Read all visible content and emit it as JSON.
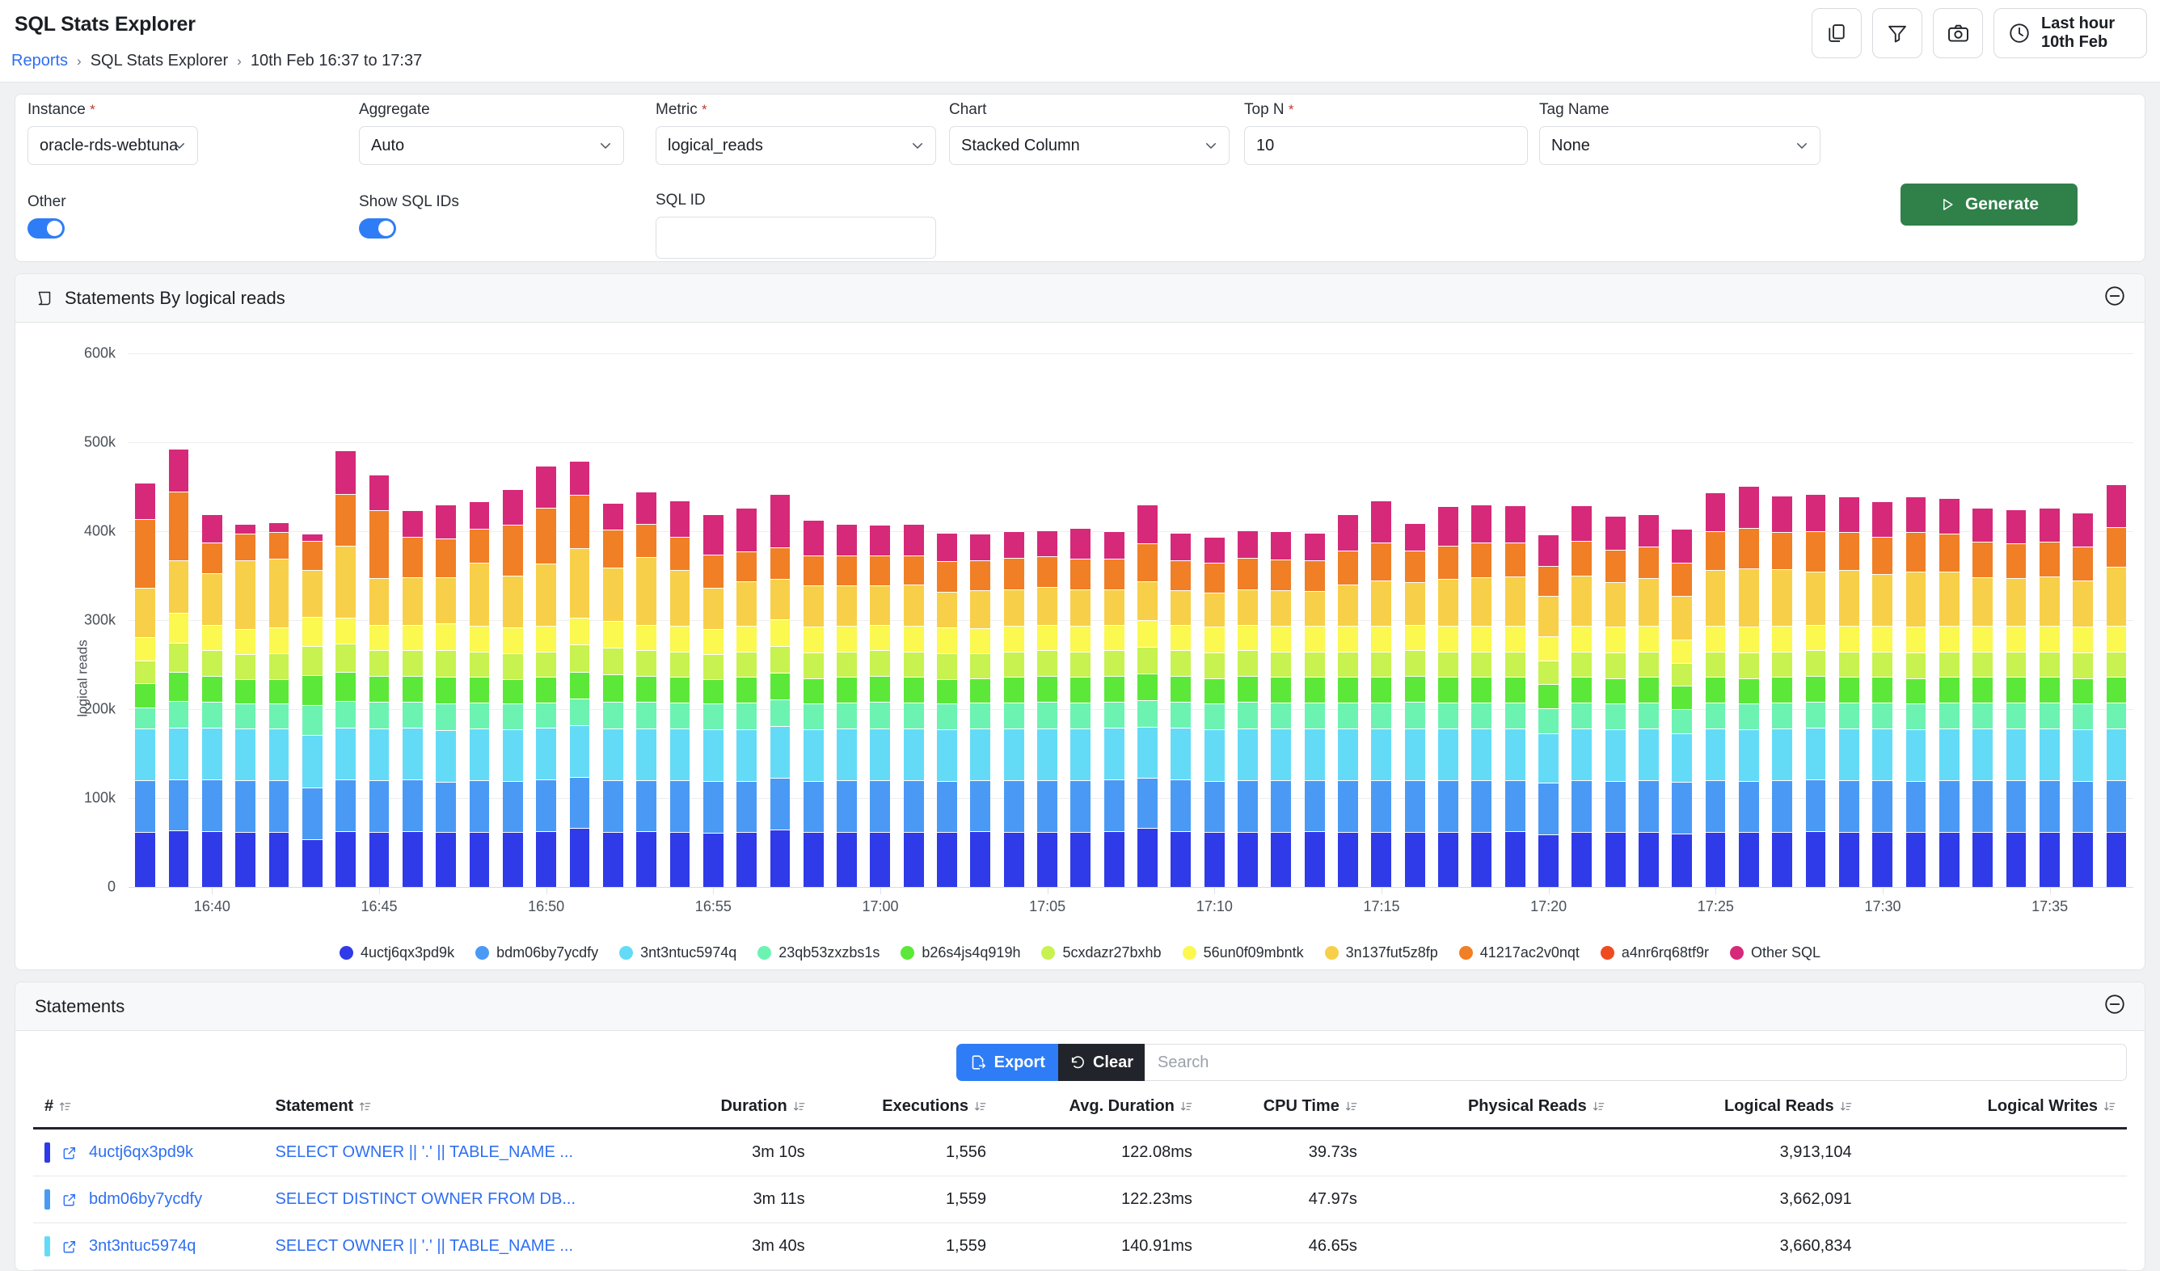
{
  "header": {
    "title": "SQL Stats Explorer",
    "breadcrumb": [
      {
        "label": "Reports",
        "link": true
      },
      {
        "label": "SQL Stats Explorer",
        "link": false
      },
      {
        "label": "10th Feb 16:37 to 17:37",
        "link": false
      }
    ],
    "actions": [
      {
        "name": "copy-icon",
        "label": "Copy"
      },
      {
        "name": "filter-icon",
        "label": "Filter"
      },
      {
        "name": "camera-icon",
        "label": "Snapshot"
      }
    ],
    "time_range": {
      "line1": "Last hour",
      "line2": "10th Feb"
    }
  },
  "filters": {
    "instance": {
      "label": "Instance",
      "required": "*",
      "value": "oracle-rds-webtuna"
    },
    "aggregate": {
      "label": "Aggregate",
      "required": "",
      "value": "Auto"
    },
    "metric": {
      "label": "Metric",
      "required": "*",
      "value": "logical_reads"
    },
    "chart": {
      "label": "Chart",
      "required": "",
      "value": "Stacked Column"
    },
    "topn": {
      "label": "Top N",
      "required": "*",
      "value": "10"
    },
    "tagname": {
      "label": "Tag Name",
      "required": "",
      "value": "None"
    },
    "other": {
      "label": "Other",
      "on": true
    },
    "show_sql_ids": {
      "label": "Show SQL IDs",
      "on": true
    },
    "sql_id": {
      "label": "SQL ID",
      "value": "",
      "placeholder": ""
    },
    "generate_label": "Generate"
  },
  "chart_panel": {
    "title": "Statements By logical reads",
    "collapse_label": "⊖"
  },
  "chart_data": {
    "type": "bar",
    "stacked": true,
    "title": "Statements By logical reads",
    "xlabel": "",
    "ylabel": "logical reads",
    "ylim": [
      0,
      600000
    ],
    "yticks": [
      0,
      100000,
      200000,
      300000,
      400000,
      500000,
      600000
    ],
    "ytick_labels": [
      "0",
      "100k",
      "200k",
      "300k",
      "400k",
      "500k",
      "600k"
    ],
    "grid": true,
    "legend_position": "bottom",
    "xtick_labels": [
      "16:40",
      "16:45",
      "16:50",
      "16:55",
      "17:00",
      "17:05",
      "17:10",
      "17:15",
      "17:20",
      "17:25",
      "17:30",
      "17:35"
    ],
    "series": [
      {
        "name": "4uctj6qx3pd9k",
        "color": "#2f3ae8",
        "values": [
          62000,
          64000,
          63000,
          62000,
          62000,
          54000,
          63000,
          62000,
          63000,
          62000,
          62000,
          62000,
          63000,
          66000,
          62000,
          63000,
          62000,
          61000,
          62000,
          65000,
          62000,
          62000,
          62000,
          62000,
          62000,
          63000,
          62000,
          62000,
          62000,
          63000,
          66000,
          63000,
          62000,
          62000,
          62000,
          63000,
          62000,
          62000,
          62000,
          62000,
          62000,
          63000,
          59000,
          62000,
          62000,
          62000,
          60000,
          62000,
          62000,
          62000,
          63000,
          62000,
          62000,
          62000,
          62000,
          62000,
          62000,
          62000,
          62000,
          62000
        ]
      },
      {
        "name": "bdm06by7ycdfy",
        "color": "#4a9af5",
        "values": [
          58000,
          57000,
          58000,
          58000,
          58000,
          58000,
          58000,
          58000,
          58000,
          56000,
          58000,
          57000,
          58000,
          58000,
          58000,
          57000,
          58000,
          58000,
          57000,
          58000,
          57000,
          58000,
          58000,
          58000,
          57000,
          57000,
          58000,
          58000,
          58000,
          58000,
          57000,
          58000,
          57000,
          58000,
          58000,
          57000,
          58000,
          58000,
          58000,
          58000,
          58000,
          57000,
          58000,
          58000,
          57000,
          58000,
          58000,
          58000,
          57000,
          58000,
          58000,
          58000,
          58000,
          57000,
          58000,
          58000,
          58000,
          58000,
          57000,
          58000
        ]
      },
      {
        "name": "3nt3ntuc5974q",
        "color": "#63dbf7",
        "values": [
          58000,
          58000,
          58000,
          58000,
          58000,
          59000,
          58000,
          58000,
          58000,
          58000,
          58000,
          58000,
          58000,
          58000,
          58000,
          58000,
          58000,
          58000,
          58000,
          58000,
          58000,
          58000,
          58000,
          58000,
          58000,
          58000,
          58000,
          58000,
          58000,
          58000,
          57000,
          58000,
          58000,
          58000,
          58000,
          58000,
          58000,
          58000,
          58000,
          58000,
          58000,
          58000,
          56000,
          58000,
          58000,
          58000,
          55000,
          58000,
          58000,
          58000,
          58000,
          58000,
          58000,
          58000,
          58000,
          58000,
          58000,
          58000,
          58000,
          58000
        ]
      },
      {
        "name": "23qb53zxzbs1s",
        "color": "#6cf3b2",
        "values": [
          24000,
          30000,
          29000,
          28000,
          28000,
          34000,
          30000,
          30000,
          29000,
          30000,
          29000,
          29000,
          28000,
          30000,
          30000,
          30000,
          29000,
          29000,
          30000,
          30000,
          29000,
          29000,
          30000,
          29000,
          29000,
          29000,
          29000,
          30000,
          29000,
          29000,
          30000,
          29000,
          29000,
          30000,
          29000,
          29000,
          29000,
          29000,
          30000,
          29000,
          29000,
          29000,
          28000,
          29000,
          29000,
          29000,
          27000,
          29000,
          29000,
          29000,
          29000,
          29000,
          29000,
          29000,
          29000,
          29000,
          29000,
          29000,
          29000,
          29000
        ]
      },
      {
        "name": "b26s4js4q919h",
        "color": "#5ce838",
        "values": [
          27000,
          33000,
          29000,
          28000,
          28000,
          33000,
          33000,
          29000,
          29000,
          30000,
          29000,
          28000,
          29000,
          30000,
          31000,
          29000,
          29000,
          28000,
          29000,
          30000,
          29000,
          29000,
          29000,
          29000,
          28000,
          28000,
          29000,
          29000,
          29000,
          29000,
          30000,
          29000,
          29000,
          29000,
          29000,
          29000,
          29000,
          29000,
          29000,
          29000,
          29000,
          29000,
          27000,
          29000,
          29000,
          29000,
          26000,
          29000,
          29000,
          29000,
          29000,
          29000,
          29000,
          29000,
          29000,
          29000,
          29000,
          29000,
          29000,
          29000
        ]
      },
      {
        "name": "5cxdazr27bxhb",
        "color": "#c7f24f",
        "values": [
          26000,
          33000,
          29000,
          28000,
          29000,
          33000,
          32000,
          29000,
          29000,
          30000,
          29000,
          29000,
          29000,
          31000,
          30000,
          29000,
          29000,
          28000,
          29000,
          30000,
          29000,
          29000,
          29000,
          29000,
          29000,
          28000,
          29000,
          29000,
          29000,
          29000,
          30000,
          29000,
          29000,
          29000,
          29000,
          29000,
          29000,
          29000,
          29000,
          29000,
          29000,
          29000,
          27000,
          29000,
          29000,
          29000,
          26000,
          29000,
          29000,
          29000,
          29000,
          29000,
          29000,
          29000,
          29000,
          29000,
          29000,
          29000,
          29000,
          29000
        ]
      },
      {
        "name": "56un0f09mbntk",
        "color": "#fbf84f",
        "values": [
          26000,
          33000,
          29000,
          28000,
          29000,
          33000,
          29000,
          29000,
          29000,
          30000,
          29000,
          29000,
          29000,
          30000,
          30000,
          29000,
          29000,
          28000,
          29000,
          30000,
          29000,
          29000,
          29000,
          29000,
          29000,
          28000,
          29000,
          29000,
          29000,
          29000,
          30000,
          29000,
          29000,
          29000,
          29000,
          29000,
          29000,
          29000,
          29000,
          29000,
          29000,
          29000,
          27000,
          29000,
          29000,
          29000,
          26000,
          29000,
          29000,
          29000,
          29000,
          29000,
          29000,
          29000,
          29000,
          29000,
          29000,
          29000,
          29000,
          29000
        ]
      },
      {
        "name": "3n137fut5z8fp",
        "color": "#f8cf48",
        "values": [
          55000,
          59000,
          58000,
          77000,
          77000,
          52000,
          81000,
          52000,
          53000,
          52000,
          71000,
          58000,
          70000,
          78000,
          60000,
          76000,
          62000,
          46000,
          50000,
          45000,
          46000,
          45000,
          44000,
          46000,
          40000,
          43000,
          41000,
          42000,
          41000,
          40000,
          44000,
          39000,
          38000,
          40000,
          40000,
          39000,
          46000,
          51000,
          48000,
          52000,
          54000,
          55000,
          45000,
          56000,
          50000,
          53000,
          49000,
          62000,
          65000,
          63000,
          60000,
          62000,
          58000,
          62000,
          61000,
          54000,
          53000,
          55000,
          52000,
          66000
        ]
      },
      {
        "name": "41217ac2v0nqt",
        "color": "#f07f26",
        "values": [
          78000,
          78000,
          34000,
          30000,
          30000,
          33000,
          58000,
          77000,
          46000,
          44000,
          38000,
          57000,
          62000,
          60000,
          43000,
          37000,
          38000,
          38000,
          33000,
          36000,
          34000,
          34000,
          34000,
          33000,
          34000,
          33000,
          35000,
          35000,
          34000,
          34000,
          42000,
          33000,
          34000,
          35000,
          34000,
          34000,
          38000,
          42000,
          35000,
          38000,
          39000,
          38000,
          34000,
          39000,
          36000,
          36000,
          38000,
          44000,
          46000,
          42000,
          45000,
          43000,
          42000,
          44000,
          42000,
          40000,
          39000,
          39000,
          38000,
          45000
        ]
      },
      {
        "name": "a4nr6rq68tf9r",
        "color": "#f04b1f",
        "values": [
          0,
          0,
          0,
          0,
          0,
          0,
          0,
          0,
          0,
          0,
          0,
          0,
          0,
          0,
          0,
          0,
          0,
          0,
          0,
          0,
          0,
          0,
          0,
          0,
          0,
          0,
          0,
          0,
          0,
          0,
          0,
          0,
          0,
          0,
          0,
          0,
          0,
          0,
          0,
          0,
          0,
          0,
          0,
          0,
          0,
          0,
          0,
          0,
          0,
          0,
          0,
          0,
          0,
          0,
          0,
          0,
          0,
          0,
          0,
          0
        ]
      },
      {
        "name": "Other SQL",
        "color": "#d6297a",
        "values": [
          41000,
          48000,
          32000,
          11000,
          11000,
          8000,
          49000,
          40000,
          30000,
          38000,
          31000,
          40000,
          48000,
          38000,
          30000,
          37000,
          41000,
          45000,
          49000,
          60000,
          40000,
          35000,
          34000,
          35000,
          32000,
          30000,
          30000,
          29000,
          35000,
          31000,
          44000,
          31000,
          29000,
          31000,
          32000,
          31000,
          41000,
          48000,
          31000,
          44000,
          43000,
          42000,
          35000,
          40000,
          38000,
          36000,
          38000,
          44000,
          47000,
          41000,
          42000,
          40000,
          40000,
          40000,
          40000,
          38000,
          39000,
          38000,
          38000,
          48000
        ]
      }
    ]
  },
  "table_panel": {
    "title": "Statements",
    "collapse_label": "⊖",
    "export_label": "Export",
    "clear_label": "Clear",
    "search_placeholder": "Search",
    "search_value": "",
    "columns": [
      {
        "label": "#",
        "align": "left",
        "sort": "asc"
      },
      {
        "label": "Statement",
        "align": "left",
        "sort": "asc"
      },
      {
        "label": "Duration",
        "align": "right",
        "sort": "desc"
      },
      {
        "label": "Executions",
        "align": "right",
        "sort": "desc"
      },
      {
        "label": "Avg. Duration",
        "align": "right",
        "sort": "desc"
      },
      {
        "label": "CPU Time",
        "align": "right",
        "sort": "desc"
      },
      {
        "label": "Physical Reads",
        "align": "right",
        "sort": "desc"
      },
      {
        "label": "Logical Reads",
        "align": "right",
        "sort": "desc"
      },
      {
        "label": "Logical Writes",
        "align": "right",
        "sort": "desc"
      }
    ],
    "rows": [
      {
        "color": "#2f3ae8",
        "sql_id": "4uctj6qx3pd9k",
        "statement": "SELECT OWNER || '.' || TABLE_NAME ...",
        "duration": "3m 10s",
        "executions": "1,556",
        "avg_duration": "122.08ms",
        "cpu_time": "39.73s",
        "physical_reads": "",
        "logical_reads": "3,913,104",
        "logical_writes": ""
      },
      {
        "color": "#4a9af5",
        "sql_id": "bdm06by7ycdfy",
        "statement": "SELECT DISTINCT OWNER FROM DB...",
        "duration": "3m 11s",
        "executions": "1,559",
        "avg_duration": "122.23ms",
        "cpu_time": "47.97s",
        "physical_reads": "",
        "logical_reads": "3,662,091",
        "logical_writes": ""
      },
      {
        "color": "#63dbf7",
        "sql_id": "3nt3ntuc5974q",
        "statement": "SELECT OWNER || '.' || TABLE_NAME ...",
        "duration": "3m 40s",
        "executions": "1,559",
        "avg_duration": "140.91ms",
        "cpu_time": "46.65s",
        "physical_reads": "",
        "logical_reads": "3,660,834",
        "logical_writes": ""
      }
    ]
  }
}
